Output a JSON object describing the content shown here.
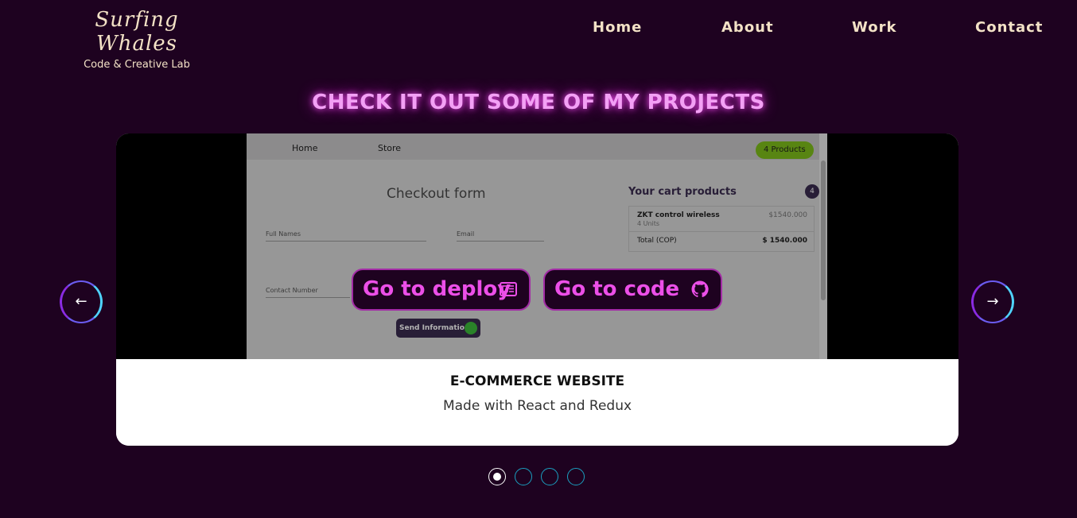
{
  "brand": {
    "title": "Surfing Whales",
    "subtitle": "Code & Creative Lab"
  },
  "nav": {
    "items": [
      "Home",
      "About",
      "Work",
      "Contact"
    ]
  },
  "section": {
    "title": "CHECK IT OUT SOME OF MY PROJECTS"
  },
  "carousel": {
    "prev_label": "←",
    "next_label": "→",
    "active_index": 0,
    "slide": {
      "title": "E-COMMERCE WEBSITE",
      "description": "Made with React and Redux",
      "deploy_label": "Go to deploy",
      "code_label": "Go to code",
      "preview": {
        "nav_home": "Home",
        "nav_store": "Store",
        "badge": "4 Products",
        "form_title": "Checkout form",
        "full_names": "Full Names",
        "email": "Email",
        "contact_number": "Contact Number",
        "send": "Send Information",
        "cart_title": "Your cart products",
        "cart_count": "4",
        "item_name": "ZKT control wireless",
        "item_units": "4 Units",
        "item_price": "$1540.000",
        "total_label": "Total (COP)",
        "total_value": "$ 1540.000"
      }
    },
    "dots": 4
  },
  "colors": {
    "background": "#1e0220",
    "accent": "#ec4fe8",
    "cream": "#f3e2c6"
  }
}
